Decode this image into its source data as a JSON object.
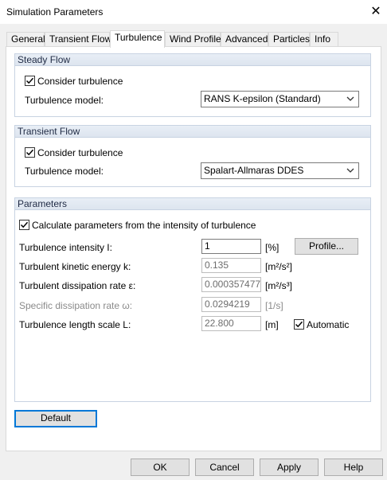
{
  "window": {
    "title": "Simulation Parameters",
    "close_glyph": "✕"
  },
  "tabs": [
    {
      "label": "General",
      "active": false
    },
    {
      "label": "Transient Flow",
      "active": false
    },
    {
      "label": "Turbulence",
      "active": true
    },
    {
      "label": "Wind Profile",
      "active": false
    },
    {
      "label": "Advanced",
      "active": false
    },
    {
      "label": "Particles",
      "active": false
    },
    {
      "label": "Info",
      "active": false
    }
  ],
  "steady_flow": {
    "title": "Steady Flow",
    "consider_label": "Consider turbulence",
    "consider_checked": true,
    "model_label": "Turbulence model:",
    "model_value": "RANS K-epsilon (Standard)"
  },
  "transient_flow": {
    "title": "Transient Flow",
    "consider_label": "Consider turbulence",
    "consider_checked": true,
    "model_label": "Turbulence model:",
    "model_value": "Spalart-Allmaras DDES"
  },
  "parameters": {
    "title": "Parameters",
    "calc_label": "Calculate parameters from the intensity of turbulence",
    "calc_checked": true,
    "rows": [
      {
        "label": "Turbulence intensity I:",
        "value": "1",
        "unit": "[%]",
        "disabled": false
      },
      {
        "label": "Turbulent kinetic energy k:",
        "value": "0.135",
        "unit": "[m²/s²]",
        "disabled": false
      },
      {
        "label": "Turbulent dissipation rate ε:",
        "value": "0.000357477",
        "unit": "[m²/s³]",
        "disabled": false
      },
      {
        "label": "Specific dissipation rate ω:",
        "value": "0.0294219",
        "unit": "[1/s]",
        "disabled": true
      },
      {
        "label": "Turbulence length scale L:",
        "value": "22.800",
        "unit": "[m]",
        "disabled": false
      }
    ],
    "profile_button": "Profile...",
    "automatic_label": "Automatic",
    "automatic_checked": true
  },
  "default_button": "Default",
  "footer": {
    "ok": "OK",
    "cancel": "Cancel",
    "apply": "Apply",
    "help": "Help"
  },
  "colors": {
    "focus_border": "#0078d7",
    "group_border": "#c8d3e2",
    "disabled_text": "#8a8a8a"
  }
}
